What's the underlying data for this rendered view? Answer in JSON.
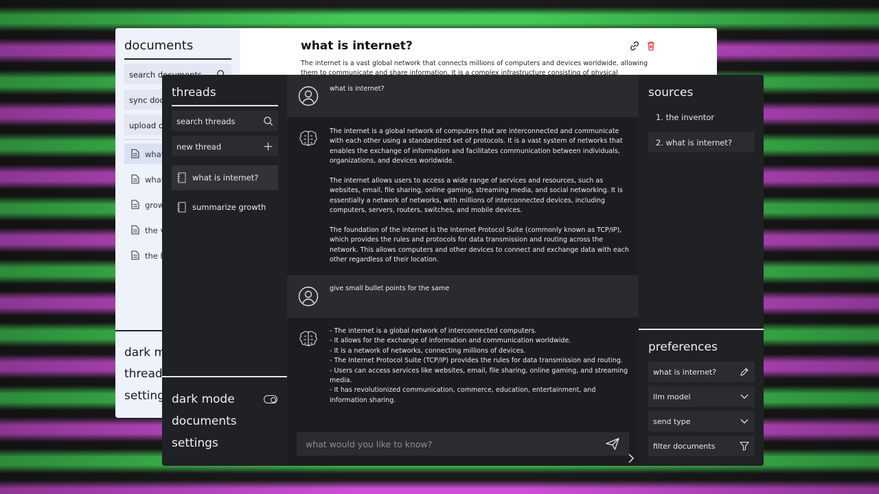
{
  "light_window": {
    "sidebar_title": "documents",
    "search_label": "search documents",
    "sync_label": "sync doc",
    "upload_label": "upload d",
    "docs": [
      "what",
      "what",
      "grow",
      "the v",
      "the h"
    ],
    "bottom": [
      "dark m",
      "thread",
      "setting"
    ],
    "main_title": "what is internet?",
    "main_text": "The internet is a vast global network that connects millions of computers and devices worldwide, allowing them to communicate and share information. It is a complex infrastructure consisting of physical"
  },
  "threads_panel": {
    "title": "threads",
    "search_label": "search threads",
    "new_label": "new thread",
    "items": [
      {
        "label": "what is internet?",
        "active": true
      },
      {
        "label": "summarize growth",
        "active": false
      }
    ],
    "bottom": {
      "dark_mode": "dark mode",
      "documents": "documents",
      "settings": "settings"
    }
  },
  "chat": {
    "messages": [
      {
        "role": "user",
        "paragraphs": [
          "what is internet?"
        ]
      },
      {
        "role": "assistant",
        "paragraphs": [
          "The internet is a global network of computers that are interconnected and communicate with each other using a standardized set of protocols. It is a vast system of networks that enables the exchange of information and facilitates communication between individuals, organizations, and devices worldwide.",
          "The internet allows users to access a wide range of services and resources, such as websites, email, file sharing, online gaming, streaming media, and social networking. It is essentially a network of networks, with millions of interconnected devices, including computers, servers, routers, switches, and mobile devices.",
          "The foundation of the internet is the Internet Protocol Suite (commonly known as TCP/IP), which provides the rules and protocols for data transmission and routing across the network. This allows computers and other devices to connect and exchange data with each other regardless of their location."
        ]
      },
      {
        "role": "user",
        "paragraphs": [
          "give small bullet points for the same"
        ]
      },
      {
        "role": "assistant",
        "lines": [
          "- The internet is a global network of interconnected computers.",
          "- It allows for the exchange of information and communication worldwide.",
          "- It is a network of networks, connecting millions of devices.",
          "- The Internet Protocol Suite (TCP/IP) provides the rules for data transmission and routing.",
          "- Users can access services like websites, email, file sharing, online gaming, and streaming media.",
          "- It has revolutionized communication, commerce, education, entertainment, and information sharing."
        ]
      }
    ],
    "input_placeholder": "what would you like to know?"
  },
  "sources_panel": {
    "title": "sources",
    "items": [
      {
        "label": "1. the inventor",
        "active": false
      },
      {
        "label": "2. what is internet?",
        "active": true
      }
    ]
  },
  "preferences_panel": {
    "title": "preferences",
    "items": [
      {
        "label": "what is internet?",
        "icon": "pencil-icon"
      },
      {
        "label": "llm model",
        "icon": "chevron-down-icon"
      },
      {
        "label": "send type",
        "icon": "chevron-down-icon"
      },
      {
        "label": "filter documents",
        "icon": "filter-icon"
      }
    ]
  },
  "colors": {
    "dark_bg": "#202124",
    "chat_bg": "#1c1d20",
    "user_msg_bg": "#2a2b2e",
    "button_bg": "#2b2c30",
    "light_sidebar_bg": "#eef2fb",
    "delete_red": "#e03131"
  }
}
